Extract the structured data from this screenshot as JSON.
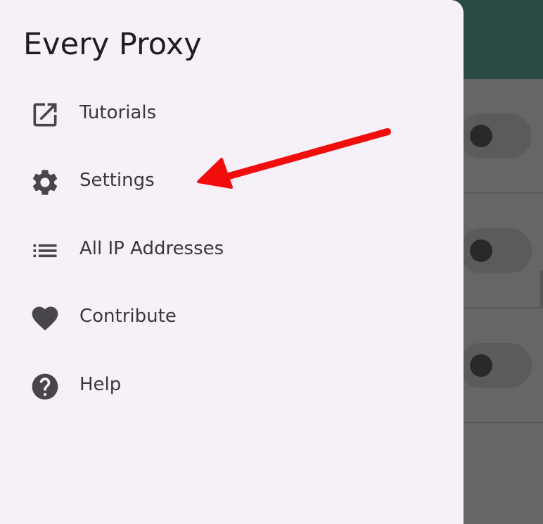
{
  "drawer": {
    "title": "Every Proxy",
    "items": [
      {
        "label": "Tutorials",
        "icon": "open-in-new-icon"
      },
      {
        "label": "Settings",
        "icon": "gear-icon"
      },
      {
        "label": "All IP Addresses",
        "icon": "list-icon"
      },
      {
        "label": "Contribute",
        "icon": "heart-icon"
      },
      {
        "label": "Help",
        "icon": "help-circle-icon"
      }
    ]
  },
  "background": {
    "toggles": [
      {
        "state": "off"
      },
      {
        "state": "off"
      },
      {
        "state": "off"
      }
    ]
  },
  "annotation": {
    "type": "arrow",
    "color": "#f20d0d",
    "points_to": "Settings"
  },
  "colors": {
    "app_bar": "#2b4a45",
    "scrim": "#676567",
    "drawer_bg": "#f6f1f8",
    "icon": "#48464a",
    "text": "#3a383b"
  }
}
